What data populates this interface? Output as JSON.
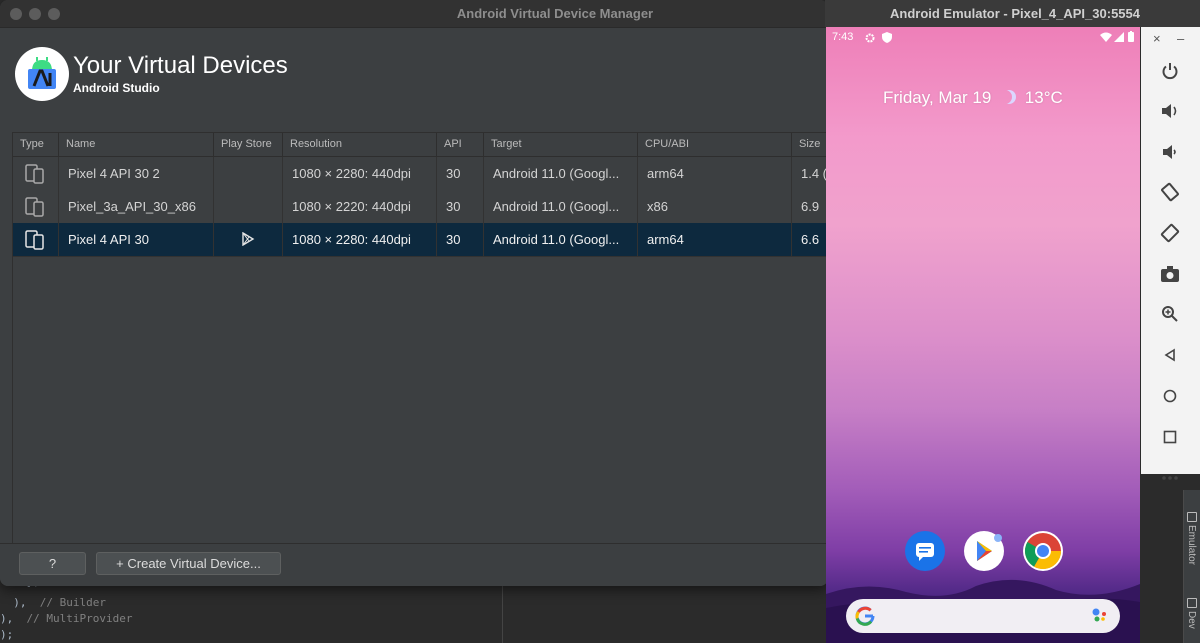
{
  "background_ide": {
    "code_lines": [
      {
        "text": "    },",
        "comment": ""
      },
      {
        "text": "  ),",
        "comment": "  // Builder"
      },
      {
        "text": "),",
        "comment": "  // MultiProvider"
      },
      {
        "text": ");",
        "comment": ""
      }
    ],
    "right_tabs": [
      "Emulator",
      "Dev"
    ]
  },
  "avd_manager": {
    "window_title": "Android Virtual Device Manager",
    "header_title": "Your Virtual Devices",
    "header_subtitle": "Android Studio",
    "columns": [
      "Type",
      "Name",
      "Play Store",
      "Resolution",
      "API",
      "Target",
      "CPU/ABI",
      "Size"
    ],
    "rows": [
      {
        "name": "Pixel 4 API 30 2",
        "play_store": false,
        "resolution": "1080 × 2280: 440dpi",
        "api": "30",
        "target": "Android 11.0 (Googl...",
        "cpu": "arm64",
        "size": "1.4 (",
        "selected": false
      },
      {
        "name": "Pixel_3a_API_30_x86",
        "play_store": false,
        "resolution": "1080 × 2220: 440dpi",
        "api": "30",
        "target": "Android 11.0 (Googl...",
        "cpu": "x86",
        "size": "6.9",
        "selected": false
      },
      {
        "name": "Pixel 4 API 30",
        "play_store": true,
        "resolution": "1080 × 2280: 440dpi",
        "api": "30",
        "target": "Android 11.0 (Googl...",
        "cpu": "arm64",
        "size": "6.6",
        "selected": true
      }
    ],
    "help_button": "?",
    "create_button": "+ Create Virtual Device..."
  },
  "emulator": {
    "window_title": "Android Emulator - Pixel_4_API_30:5554",
    "status_time": "7:43",
    "glance_date": "Friday, Mar 19",
    "glance_temp": "13°C",
    "dock_apps": [
      "messages-icon",
      "play-store-icon",
      "chrome-icon"
    ],
    "close_glyph": "×",
    "minimize_glyph": "–",
    "toolbar": [
      "power-icon",
      "volume-up-icon",
      "volume-down-icon",
      "rotate-left-icon",
      "rotate-right-icon",
      "screenshot-icon",
      "zoom-icon",
      "back-icon",
      "home-icon",
      "overview-icon",
      "more-icon"
    ]
  },
  "colors": {
    "selection": "#0d293e",
    "android_green": "#3ddc84",
    "studio_blue": "#4285f4"
  }
}
